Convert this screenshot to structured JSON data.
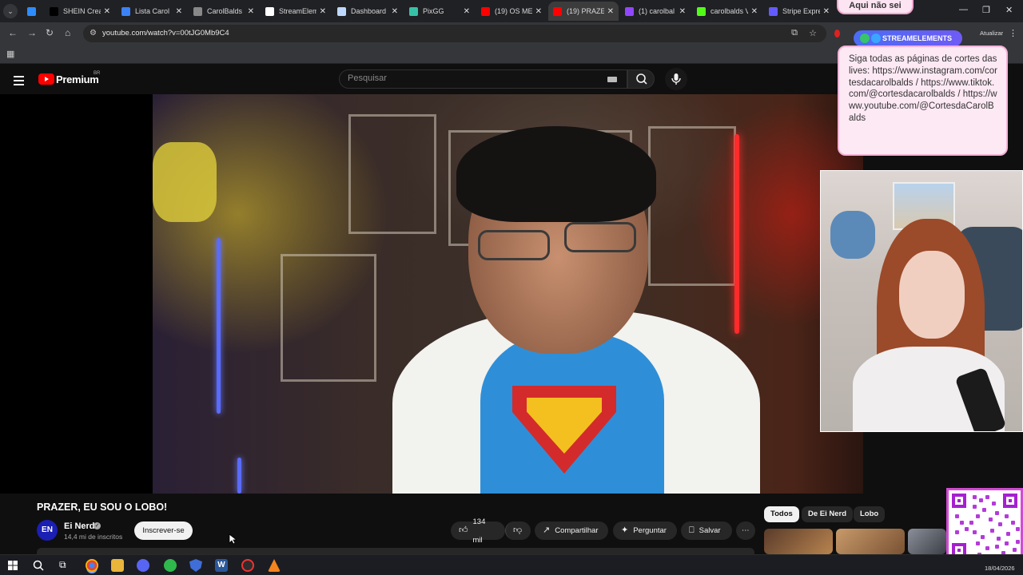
{
  "browser": {
    "tabs": [
      {
        "label": "",
        "favicon": "diamond-icon",
        "color": "#2d8cff"
      },
      {
        "label": "SHEIN Crea",
        "favicon": "shein-icon",
        "color": "#000000"
      },
      {
        "label": "Lista Carol",
        "favicon": "cloud-icon",
        "color": "#3b82f6"
      },
      {
        "label": "CarolBalds",
        "favicon": "gear-icon",
        "color": "#888888"
      },
      {
        "label": "StreamElem",
        "favicon": "streamelements-icon",
        "color": "#ffffff"
      },
      {
        "label": "Dashboard",
        "favicon": "globe-icon",
        "color": "#bdd7ff"
      },
      {
        "label": "PixGG",
        "favicon": "pix-icon",
        "color": "#36c2a6"
      },
      {
        "label": "(19) OS ME",
        "favicon": "youtube-icon",
        "color": "#ff0000"
      },
      {
        "label": "(19) PRAZE",
        "favicon": "youtube-icon",
        "color": "#ff0000",
        "active": true
      },
      {
        "label": "(1) carolbal",
        "favicon": "twitch-icon",
        "color": "#9146ff"
      },
      {
        "label": "carolbalds V",
        "favicon": "kick-icon",
        "color": "#53fc18"
      },
      {
        "label": "Stripe Expre",
        "favicon": "stripe-icon",
        "color": "#635bff"
      }
    ],
    "url": "youtube.com/watch?v=00tJG0Mb9C4",
    "update_label": "Atualizar"
  },
  "youtube": {
    "brand": "Premium",
    "region": "BR",
    "search_placeholder": "Pesquisar",
    "video_title": "PRAZER, EU SOU O LOBO!",
    "channel": {
      "name": "Ei Nerd",
      "subscribers": "14,4 mi de inscritos",
      "avatar_text": "EN"
    },
    "subscribe_label": "Inscrever-se",
    "actions": {
      "likes": "134 mil",
      "share": "Compartilhar",
      "ask": "Perguntar",
      "save": "Salvar"
    },
    "chips": [
      "Todos",
      "De Ei Nerd",
      "Lobo"
    ]
  },
  "stream_overlay": {
    "chat_message": "Aqui não sei",
    "badge": "STREAMELEMENTS",
    "cortes_text": "Siga todas as páginas de cortes das lives: https://www.instagram.com/cortesdacarolbalds / https://www.tiktok.com/@cortesdacarolbalds / https://www.youtube.com/@CortesdaCarolBalds"
  },
  "taskbar": {
    "date": "18/04/2026"
  }
}
